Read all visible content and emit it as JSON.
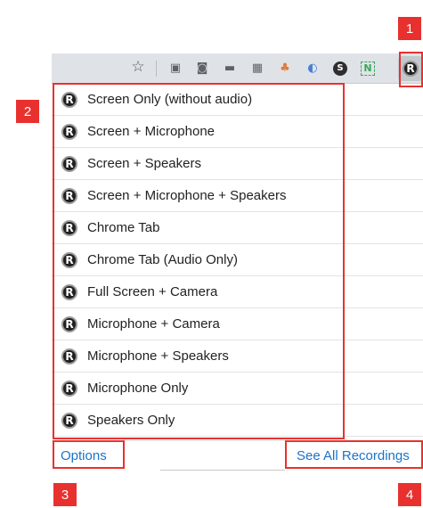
{
  "toolbar": {
    "icons": [
      {
        "name": "bookmark-star-icon",
        "glyph": "☆",
        "color": "#555555"
      },
      {
        "name": "cast-icon",
        "glyph": "▣",
        "color": "#5f6368"
      },
      {
        "name": "camera-icon",
        "glyph": "◙",
        "color": "#5f6368"
      },
      {
        "name": "monitor-icon",
        "glyph": "▬",
        "color": "#3c4043"
      },
      {
        "name": "grid-icon",
        "glyph": "▦",
        "color": "#3c4043"
      },
      {
        "name": "extension-puzzle-icon",
        "glyph": "♣",
        "color": "#e07b39"
      },
      {
        "name": "half-moon-icon",
        "glyph": "◐",
        "color": "#4a7fd4"
      },
      {
        "name": "s-circle-icon",
        "glyph": "S",
        "color": "#2e2e2e"
      },
      {
        "name": "n-notion-icon",
        "glyph": "N",
        "color": "#3aa757"
      }
    ],
    "active_extension_glyph": "R"
  },
  "menu": {
    "items": [
      {
        "label": "Screen Only (without audio)"
      },
      {
        "label": "Screen + Microphone"
      },
      {
        "label": "Screen + Speakers"
      },
      {
        "label": "Screen + Microphone + Speakers"
      },
      {
        "label": "Chrome Tab"
      },
      {
        "label": "Chrome Tab (Audio Only)"
      },
      {
        "label": "Full Screen + Camera"
      },
      {
        "label": "Microphone + Camera"
      },
      {
        "label": "Microphone + Speakers"
      },
      {
        "label": "Microphone Only"
      },
      {
        "label": "Speakers Only"
      }
    ],
    "logo_glyph": "R"
  },
  "footer": {
    "options_label": "Options",
    "see_all_label": "See All Recordings"
  },
  "callouts": [
    "1",
    "2",
    "3",
    "4"
  ],
  "colors": {
    "callout_red": "#e8312f",
    "link_blue": "#1a73c8",
    "toolbar_bg": "#dfe3e8"
  }
}
